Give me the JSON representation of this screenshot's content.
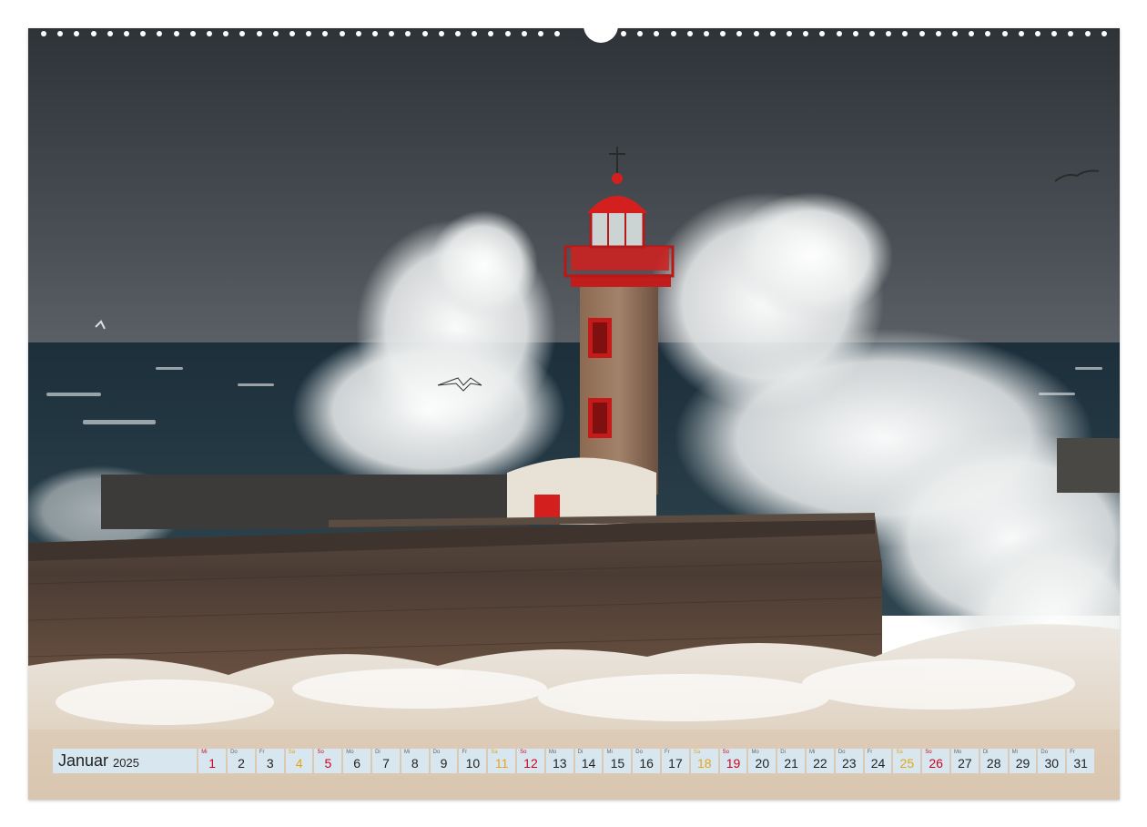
{
  "calendar": {
    "month": "Januar",
    "year": "2025",
    "days": [
      {
        "dow": "Mi",
        "num": "1",
        "type": "sun"
      },
      {
        "dow": "Do",
        "num": "2",
        "type": "weekday"
      },
      {
        "dow": "Fr",
        "num": "3",
        "type": "weekday"
      },
      {
        "dow": "Sa",
        "num": "4",
        "type": "sat"
      },
      {
        "dow": "So",
        "num": "5",
        "type": "sun"
      },
      {
        "dow": "Mo",
        "num": "6",
        "type": "weekday"
      },
      {
        "dow": "Di",
        "num": "7",
        "type": "weekday"
      },
      {
        "dow": "Mi",
        "num": "8",
        "type": "weekday"
      },
      {
        "dow": "Do",
        "num": "9",
        "type": "weekday"
      },
      {
        "dow": "Fr",
        "num": "10",
        "type": "weekday"
      },
      {
        "dow": "Sa",
        "num": "11",
        "type": "sat"
      },
      {
        "dow": "So",
        "num": "12",
        "type": "sun"
      },
      {
        "dow": "Mo",
        "num": "13",
        "type": "weekday"
      },
      {
        "dow": "Di",
        "num": "14",
        "type": "weekday"
      },
      {
        "dow": "Mi",
        "num": "15",
        "type": "weekday"
      },
      {
        "dow": "Do",
        "num": "16",
        "type": "weekday"
      },
      {
        "dow": "Fr",
        "num": "17",
        "type": "weekday"
      },
      {
        "dow": "Sa",
        "num": "18",
        "type": "sat"
      },
      {
        "dow": "So",
        "num": "19",
        "type": "sun"
      },
      {
        "dow": "Mo",
        "num": "20",
        "type": "weekday"
      },
      {
        "dow": "Di",
        "num": "21",
        "type": "weekday"
      },
      {
        "dow": "Mi",
        "num": "22",
        "type": "weekday"
      },
      {
        "dow": "Do",
        "num": "23",
        "type": "weekday"
      },
      {
        "dow": "Fr",
        "num": "24",
        "type": "weekday"
      },
      {
        "dow": "Sa",
        "num": "25",
        "type": "sat"
      },
      {
        "dow": "So",
        "num": "26",
        "type": "sun"
      },
      {
        "dow": "Mo",
        "num": "27",
        "type": "weekday"
      },
      {
        "dow": "Di",
        "num": "28",
        "type": "weekday"
      },
      {
        "dow": "Mi",
        "num": "29",
        "type": "weekday"
      },
      {
        "dow": "Do",
        "num": "30",
        "type": "weekday"
      },
      {
        "dow": "Fr",
        "num": "31",
        "type": "weekday"
      }
    ]
  },
  "colors": {
    "sky": "#3b4045",
    "sea": "#1f3440",
    "lighthouse_red": "#d3201f",
    "stone": "#7a5a44",
    "spray": "#f1f1ef",
    "sunday": "#d0021b",
    "saturday": "#e8a317"
  },
  "photo": {
    "subject": "lighthouse-in-storm"
  }
}
